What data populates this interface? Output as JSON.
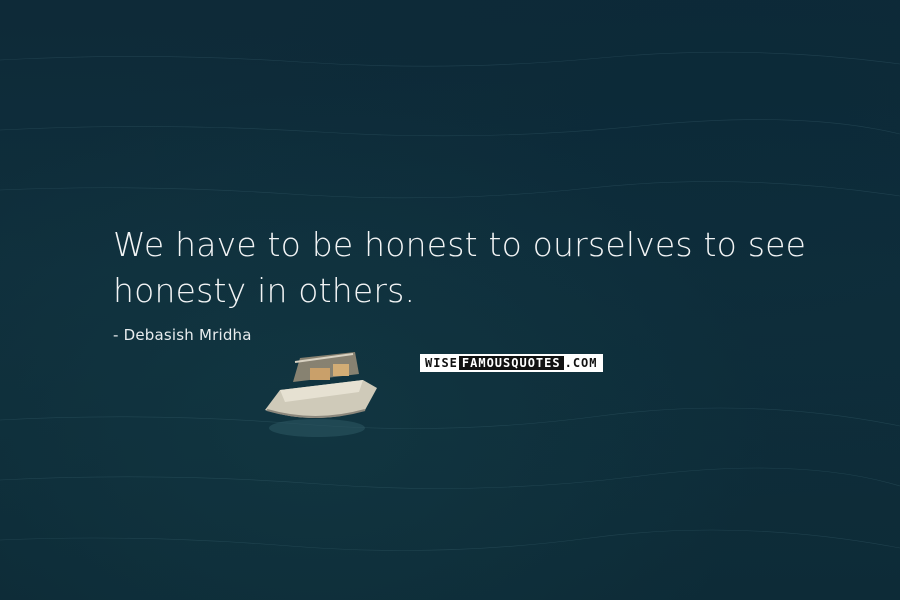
{
  "quote": {
    "text": "We have to be honest to ourselves to see honesty in others."
  },
  "author": {
    "text": "- Debasish Mridha"
  },
  "logo": {
    "part_wise": "WISE",
    "part_famousquotes": "FAMOUSQUOTES",
    "part_com": ".COM"
  },
  "colors": {
    "background": "#0f2f3c",
    "text": "#f2f4f5"
  }
}
